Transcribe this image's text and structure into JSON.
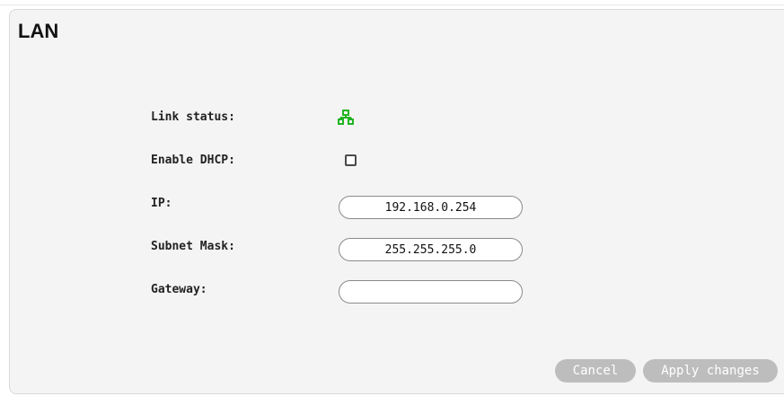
{
  "section": {
    "title": "LAN"
  },
  "fields": {
    "link_status_label": "Link status:",
    "link_status_icon": "network-connected-icon",
    "link_status_color": "#22b422",
    "enable_dhcp_label": "Enable DHCP:",
    "enable_dhcp_checked": false,
    "ip_label": "IP:",
    "ip_value": "192.168.0.254",
    "subnet_mask_label": "Subnet Mask:",
    "subnet_mask_value": "255.255.255.0",
    "gateway_label": "Gateway:",
    "gateway_value": ""
  },
  "actions": {
    "cancel_label": "Cancel",
    "apply_label": "Apply changes"
  }
}
